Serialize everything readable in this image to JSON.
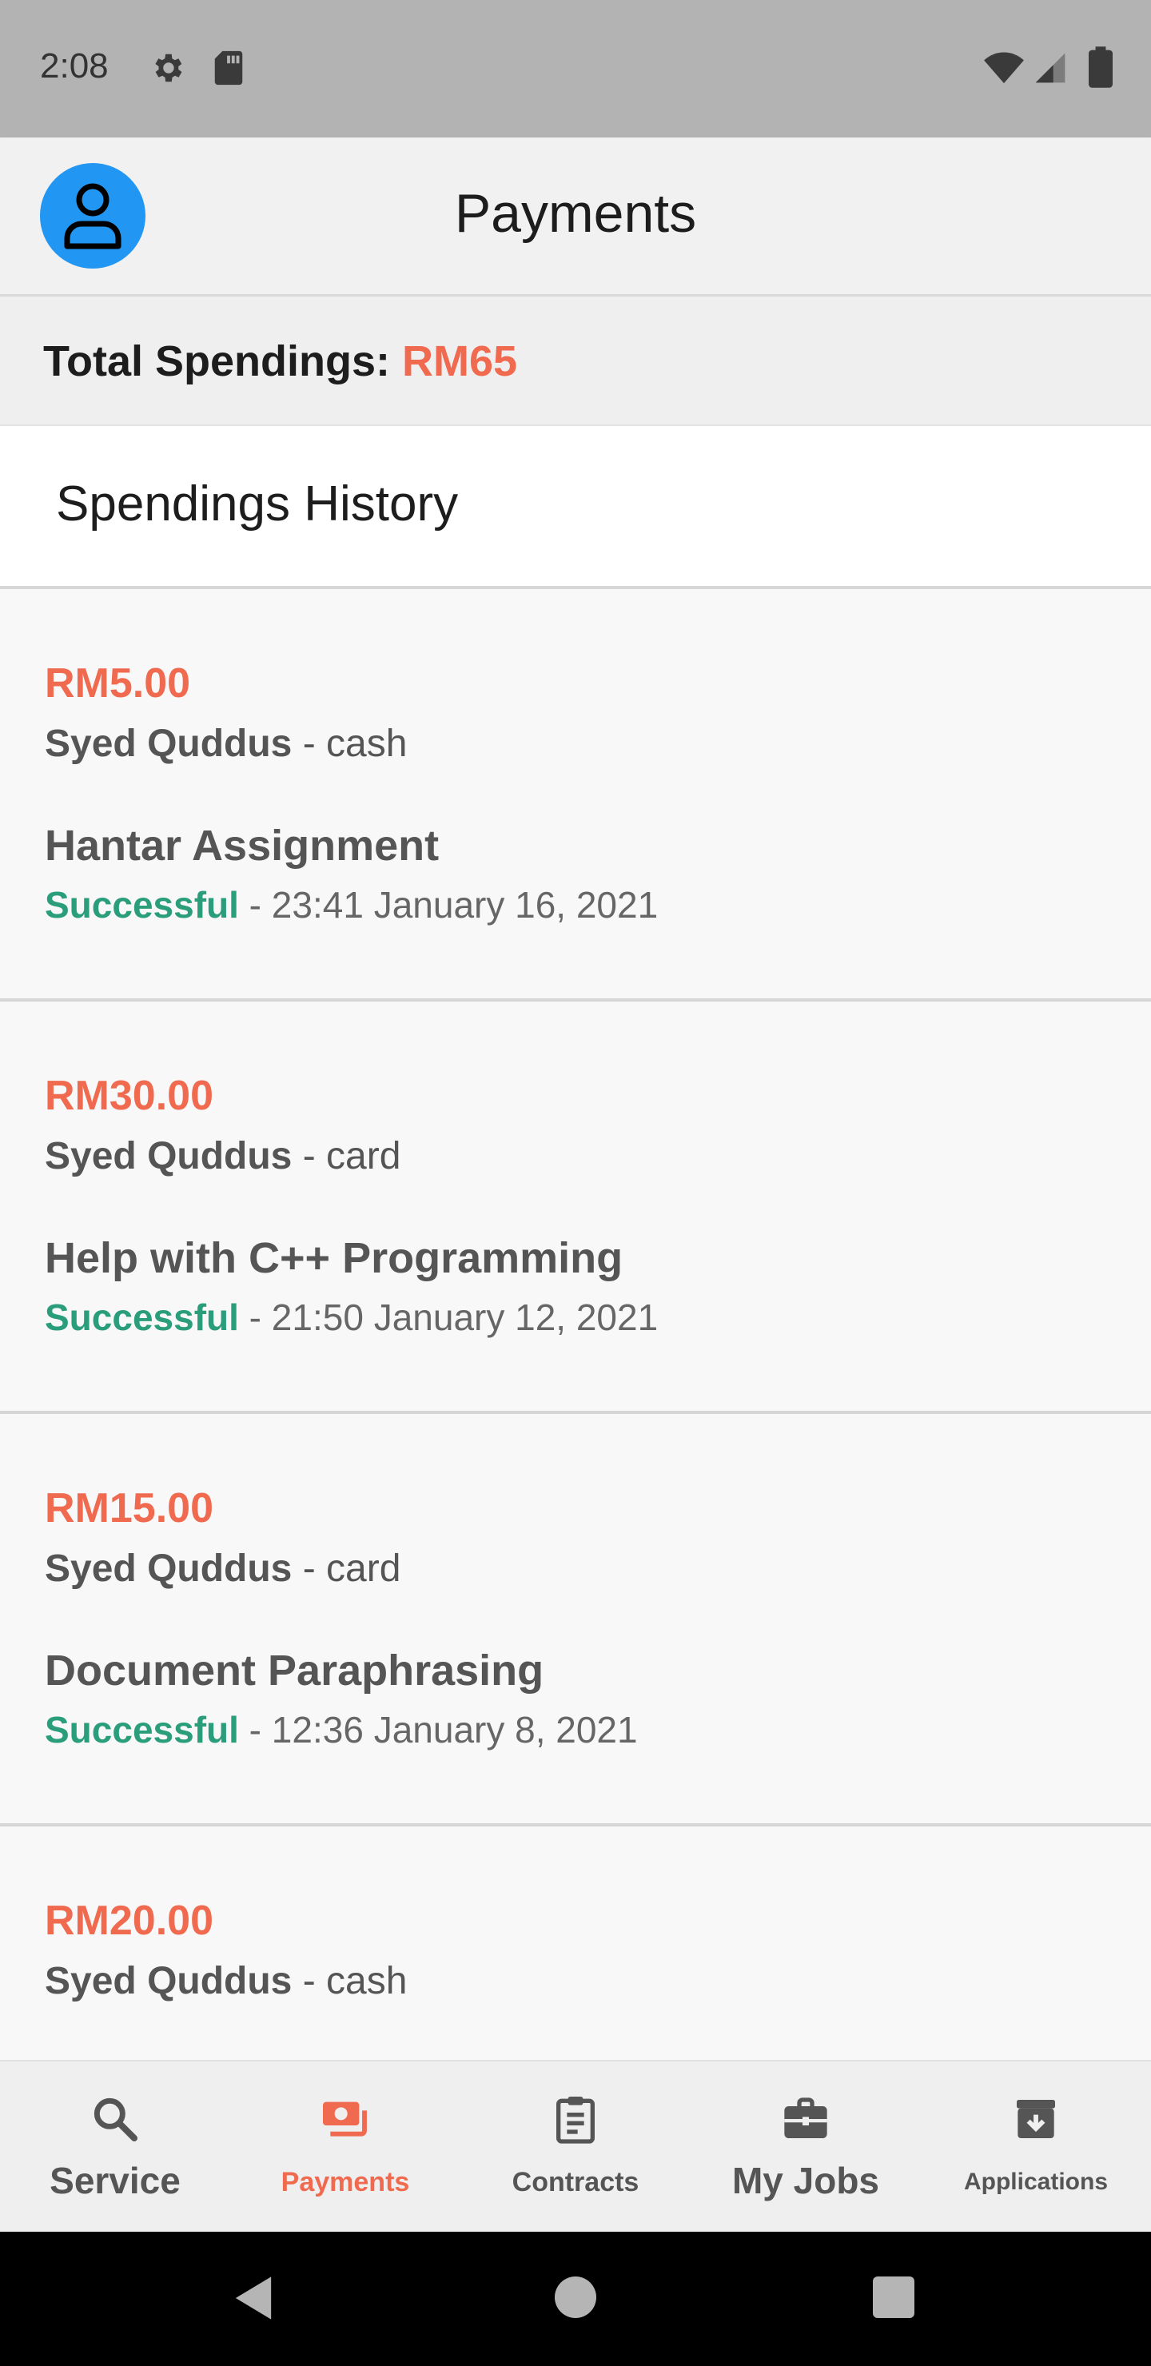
{
  "status_bar": {
    "time": "2:08",
    "icons": [
      "gear-icon",
      "sd-card-icon",
      "wifi-icon",
      "signal-icon",
      "battery-icon"
    ]
  },
  "header": {
    "title": "Payments",
    "avatar_icon": "person-icon",
    "avatar_color": "#2196f3"
  },
  "summary": {
    "label": "Total Spendings:",
    "value": "RM65"
  },
  "history": {
    "title": "Spendings History",
    "items": [
      {
        "amount": "RM5.00",
        "payer": "Syed Quddus",
        "method": "cash",
        "service": "Hantar Assignment",
        "status": "Successful",
        "datetime": "23:41 January 16, 2021"
      },
      {
        "amount": "RM30.00",
        "payer": "Syed Quddus",
        "method": "card",
        "service": "Help with C++ Programming",
        "status": "Successful",
        "datetime": "21:50 January 12, 2021"
      },
      {
        "amount": "RM15.00",
        "payer": "Syed Quddus",
        "method": "card",
        "service": "Document Paraphrasing",
        "status": "Successful",
        "datetime": "12:36 January 8, 2021"
      },
      {
        "amount": "RM20.00",
        "payer": "Syed Quddus",
        "method": "cash",
        "service": "",
        "status": "",
        "datetime": ""
      }
    ]
  },
  "bottom_nav": {
    "items": [
      {
        "label": "Service",
        "icon": "search-icon"
      },
      {
        "label": "Payments",
        "icon": "payments-icon"
      },
      {
        "label": "Contracts",
        "icon": "clipboard-icon"
      },
      {
        "label": "My Jobs",
        "icon": "briefcase-icon"
      },
      {
        "label": "Applications",
        "icon": "archive-icon"
      }
    ],
    "active": "Payments"
  },
  "colors": {
    "accent": "#f06a50",
    "success": "#2a9d7a",
    "avatar": "#2196f3"
  }
}
